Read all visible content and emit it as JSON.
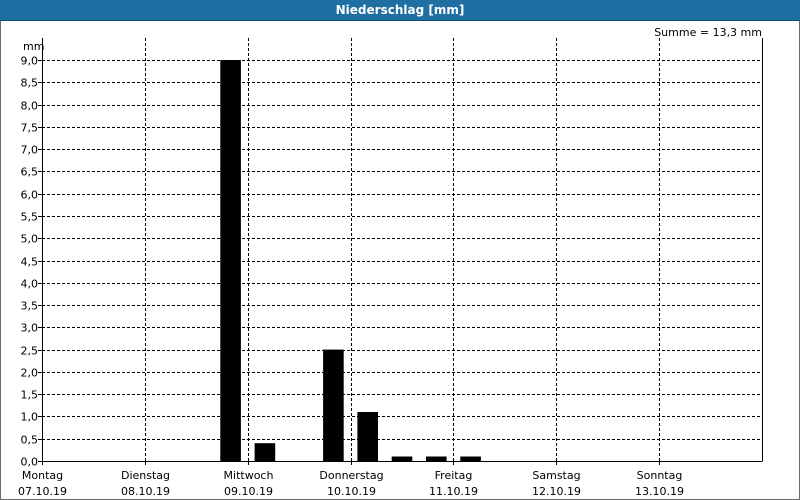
{
  "window": {
    "title": "Niederschlag [mm]"
  },
  "summary": "Summe = 13,3 mm",
  "colors": {
    "titlebar": "#1f6fa3",
    "bars": "#000000",
    "grid": "#000000"
  },
  "chart_data": {
    "type": "bar",
    "title": "Niederschlag [mm]",
    "ylabel": "mm",
    "xlabel": "",
    "ylim": [
      0,
      9.0
    ],
    "ytick_step": 0.5,
    "yticks": [
      "0,0",
      "0,5",
      "1,0",
      "1,5",
      "2,0",
      "2,5",
      "3,0",
      "3,5",
      "4,0",
      "4,5",
      "5,0",
      "5,5",
      "6,0",
      "6,5",
      "7,0",
      "7,5",
      "8,0",
      "8,5",
      "9,0"
    ],
    "grid": true,
    "days": [
      {
        "name": "Montag",
        "date": "07.10.19"
      },
      {
        "name": "Dienstag",
        "date": "08.10.19"
      },
      {
        "name": "Mittwoch",
        "date": "09.10.19"
      },
      {
        "name": "Donnerstag",
        "date": "10.10.19"
      },
      {
        "name": "Freitag",
        "date": "11.10.19"
      },
      {
        "name": "Samstag",
        "date": "12.10.19"
      },
      {
        "name": "Sonntag",
        "date": "13.10.19"
      }
    ],
    "bar_interval_hours": 8,
    "values": [
      0,
      0,
      0,
      0,
      0,
      9.0,
      0.4,
      0,
      2.5,
      1.1,
      0.1,
      0.1,
      0.1,
      0,
      0,
      0,
      0,
      0,
      0,
      0,
      0
    ],
    "summary": "Summe = 13,3 mm"
  }
}
